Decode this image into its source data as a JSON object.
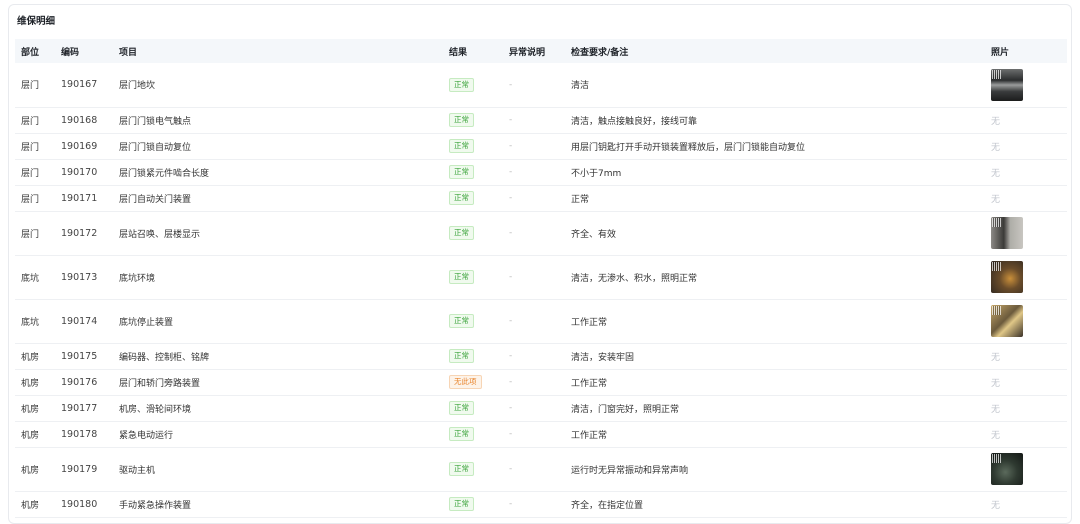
{
  "section_title": "维保明细",
  "columns": {
    "part": "部位",
    "code": "编码",
    "item": "项目",
    "result": "结果",
    "abnormal": "异常说明",
    "requirement": "检查要求/备注",
    "photo": "照片"
  },
  "rows": [
    {
      "part": "层门",
      "code": "190167",
      "item": "层门地坎",
      "result": "正常",
      "result_type": "ok",
      "abnormal": "-",
      "requirement": "清洁",
      "photo": "photo",
      "photo_style": "ph1"
    },
    {
      "part": "层门",
      "code": "190168",
      "item": "层门门锁电气触点",
      "result": "正常",
      "result_type": "ok",
      "abnormal": "-",
      "requirement": "清洁，触点接触良好，接线可靠",
      "photo": "无"
    },
    {
      "part": "层门",
      "code": "190169",
      "item": "层门门锁自动复位",
      "result": "正常",
      "result_type": "ok",
      "abnormal": "-",
      "requirement": "用层门钥匙打开手动开锁装置释放后，层门门锁能自动复位",
      "photo": "无"
    },
    {
      "part": "层门",
      "code": "190170",
      "item": "层门锁紧元件啮合长度",
      "result": "正常",
      "result_type": "ok",
      "abnormal": "-",
      "requirement": "不小于7mm",
      "photo": "无"
    },
    {
      "part": "层门",
      "code": "190171",
      "item": "层门自动关门装置",
      "result": "正常",
      "result_type": "ok",
      "abnormal": "-",
      "requirement": "正常",
      "photo": "无"
    },
    {
      "part": "层门",
      "code": "190172",
      "item": "层站召唤、层楼显示",
      "result": "正常",
      "result_type": "ok",
      "abnormal": "-",
      "requirement": "齐全、有效",
      "photo": "photo",
      "photo_style": "ph2"
    },
    {
      "part": "底坑",
      "code": "190173",
      "item": "底坑环境",
      "result": "正常",
      "result_type": "ok",
      "abnormal": "-",
      "requirement": "清洁，无渗水、积水，照明正常",
      "photo": "photo",
      "photo_style": "ph3"
    },
    {
      "part": "底坑",
      "code": "190174",
      "item": "底坑停止装置",
      "result": "正常",
      "result_type": "ok",
      "abnormal": "-",
      "requirement": "工作正常",
      "photo": "photo",
      "photo_style": "ph4"
    },
    {
      "part": "机房",
      "code": "190175",
      "item": "编码器、控制柜、铭牌",
      "result": "正常",
      "result_type": "ok",
      "abnormal": "-",
      "requirement": "清洁，安装牢固",
      "photo": "无"
    },
    {
      "part": "机房",
      "code": "190176",
      "item": "层门和轿门旁路装置",
      "result": "无此项",
      "result_type": "warn",
      "abnormal": "-",
      "requirement": "工作正常",
      "photo": "无"
    },
    {
      "part": "机房",
      "code": "190177",
      "item": "机房、滑轮间环境",
      "result": "正常",
      "result_type": "ok",
      "abnormal": "-",
      "requirement": "清洁，门窗完好，照明正常",
      "photo": "无"
    },
    {
      "part": "机房",
      "code": "190178",
      "item": "紧急电动运行",
      "result": "正常",
      "result_type": "ok",
      "abnormal": "-",
      "requirement": "工作正常",
      "photo": "无"
    },
    {
      "part": "机房",
      "code": "190179",
      "item": "驱动主机",
      "result": "正常",
      "result_type": "ok",
      "abnormal": "-",
      "requirement": "运行时无异常振动和异常声响",
      "photo": "photo",
      "photo_style": "ph5"
    },
    {
      "part": "机房",
      "code": "190180",
      "item": "手动紧急操作装置",
      "result": "正常",
      "result_type": "ok",
      "abnormal": "-",
      "requirement": "齐全，在指定位置",
      "photo": "无"
    }
  ],
  "colors": {
    "ok": "#3aa33a",
    "warn": "#e8842c",
    "header_bg": "#f4f7fa"
  }
}
